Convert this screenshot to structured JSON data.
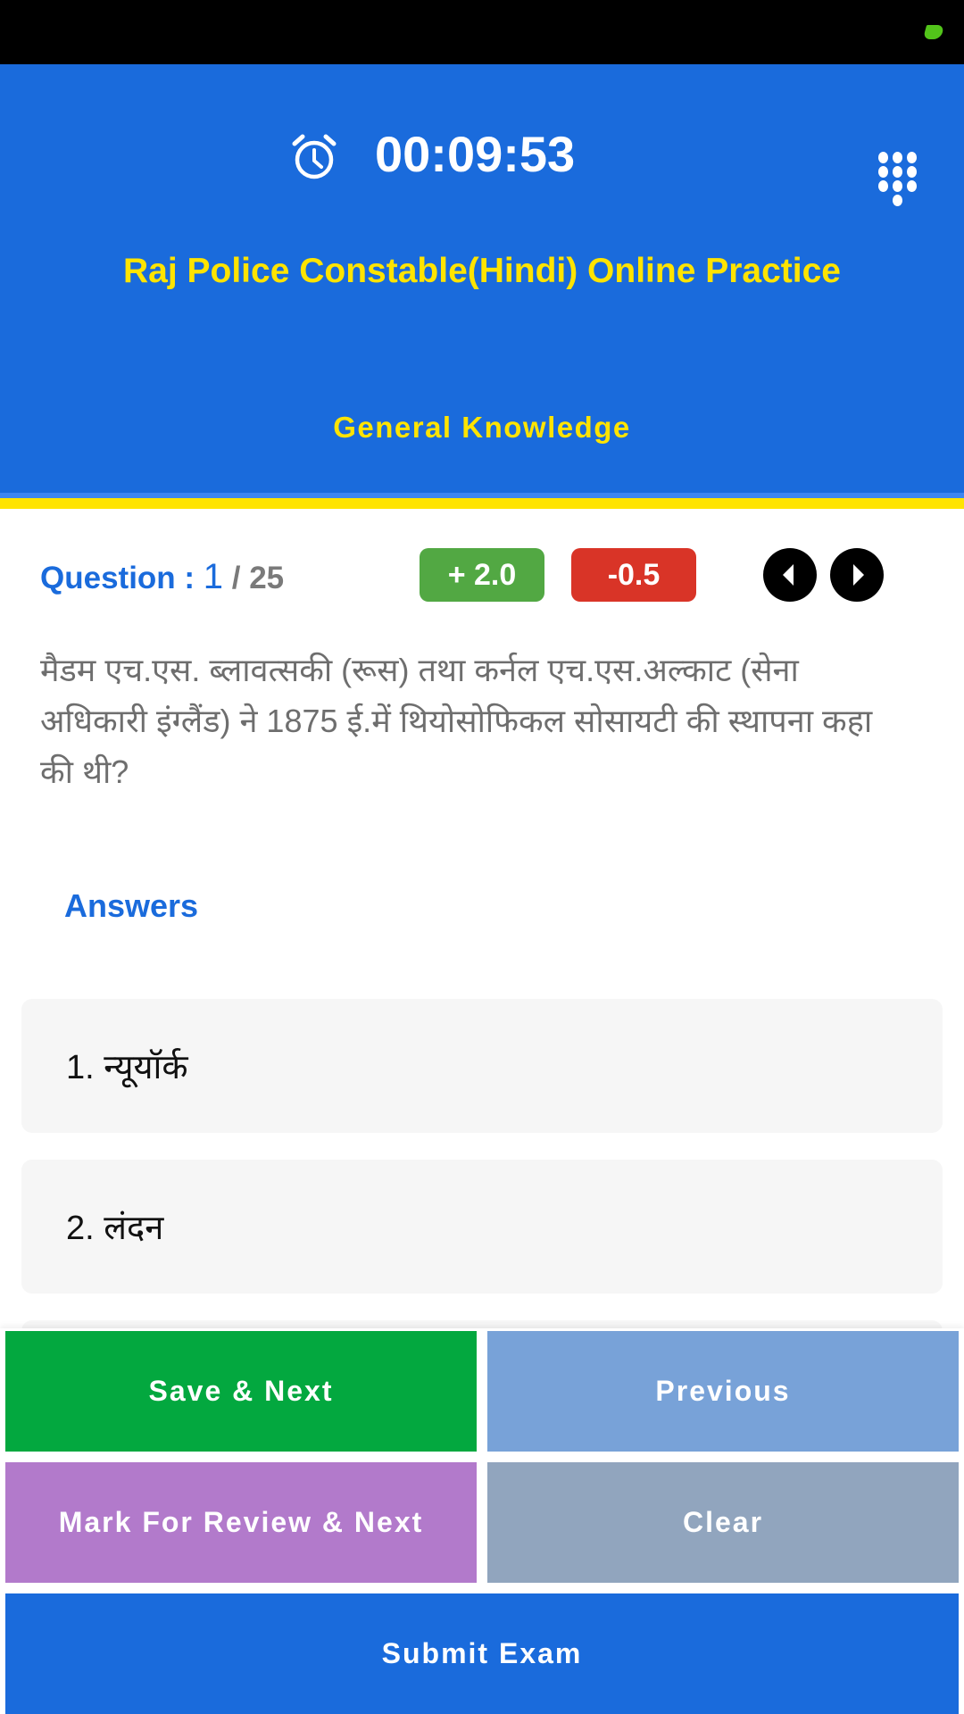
{
  "status_bar": {
    "indicator_color": "#52c41a"
  },
  "header": {
    "timer_icon": "alarm-clock-icon",
    "timer": "00:09:53",
    "menu_icon": "dialpad-grid-icon",
    "exam_title": "Raj Police Constable(Hindi) Online Practice",
    "section_title": "General Knowledge",
    "colors": {
      "background": "#1a6bdc",
      "title": "#ffe400"
    }
  },
  "question_bar": {
    "label": "Question : ",
    "current": "1",
    "total": " / 25",
    "positive_marks": "+ 2.0",
    "negative_marks": "-0.5",
    "prev_icon": "caret-left-icon",
    "next_icon": "caret-right-icon"
  },
  "question": {
    "text": "मैडम एच.एस. ब्लावत्सकी (रूस) तथा कर्नल एच.एस.अल्काट (सेना अधिकारी इंग्लैंड) ने 1875 ई.में थियोसोफिकल सोसायटी की स्थापना कहा की थी?"
  },
  "answers": {
    "heading": "Answers",
    "options": [
      {
        "label": "1. न्यूयॉर्क"
      },
      {
        "label": "2.   लंदन"
      }
    ]
  },
  "actions": {
    "save_next": "Save & Next",
    "previous": "Previous",
    "mark_review_next": "Mark For Review & Next",
    "clear": "Clear",
    "submit": "Submit Exam"
  }
}
